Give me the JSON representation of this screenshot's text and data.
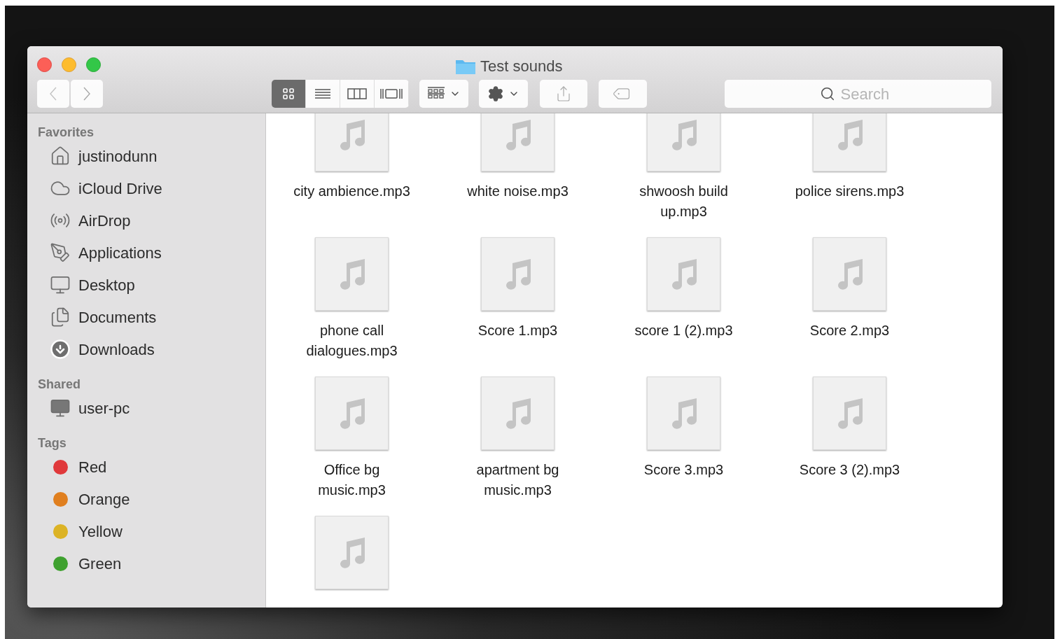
{
  "window": {
    "title": "Test sounds"
  },
  "toolbar": {
    "views": [
      {
        "kind": "icons",
        "selected": true
      },
      {
        "kind": "list",
        "selected": false
      },
      {
        "kind": "columns",
        "selected": false
      },
      {
        "kind": "coverflow",
        "selected": false
      }
    ],
    "search": {
      "placeholder": "Search"
    }
  },
  "sidebar": {
    "sections": [
      {
        "title": "Favorites",
        "items": [
          {
            "label": "justinodunn",
            "kind": "home"
          },
          {
            "label": "iCloud Drive",
            "kind": "cloud"
          },
          {
            "label": "AirDrop",
            "kind": "airdrop"
          },
          {
            "label": "Applications",
            "kind": "apps"
          },
          {
            "label": "Desktop",
            "kind": "desktop"
          },
          {
            "label": "Documents",
            "kind": "documents"
          },
          {
            "label": "Downloads",
            "kind": "downloads"
          }
        ]
      },
      {
        "title": "Shared",
        "items": [
          {
            "label": "user-pc",
            "kind": "computer"
          }
        ]
      },
      {
        "title": "Tags",
        "items": [
          {
            "label": "Red",
            "kind": "tag",
            "color": "#e0393b"
          },
          {
            "label": "Orange",
            "kind": "tag",
            "color": "#e07f1f"
          },
          {
            "label": "Yellow",
            "kind": "tag",
            "color": "#dcb325"
          },
          {
            "label": "Green",
            "kind": "tag",
            "color": "#3fa12f"
          }
        ]
      }
    ]
  },
  "files": [
    {
      "kind": "audio",
      "name": "city ambience.mp3"
    },
    {
      "kind": "audio",
      "name": "white noise.mp3"
    },
    {
      "kind": "audio",
      "name": "shwoosh build up.mp3"
    },
    {
      "kind": "audio",
      "name": "police sirens.mp3"
    },
    {
      "kind": "audio",
      "name": "phone call dialogues.mp3"
    },
    {
      "kind": "audio",
      "name": "Score 1.mp3"
    },
    {
      "kind": "audio",
      "name": "score 1 (2).mp3"
    },
    {
      "kind": "audio",
      "name": "Score 2.mp3"
    },
    {
      "kind": "audio",
      "name": "Office bg music.mp3"
    },
    {
      "kind": "audio",
      "name": "apartment bg music.mp3"
    },
    {
      "kind": "audio",
      "name": "Score 3.mp3"
    },
    {
      "kind": "audio",
      "name": "Score 3 (2).mp3"
    },
    {
      "kind": "audio"
    }
  ]
}
